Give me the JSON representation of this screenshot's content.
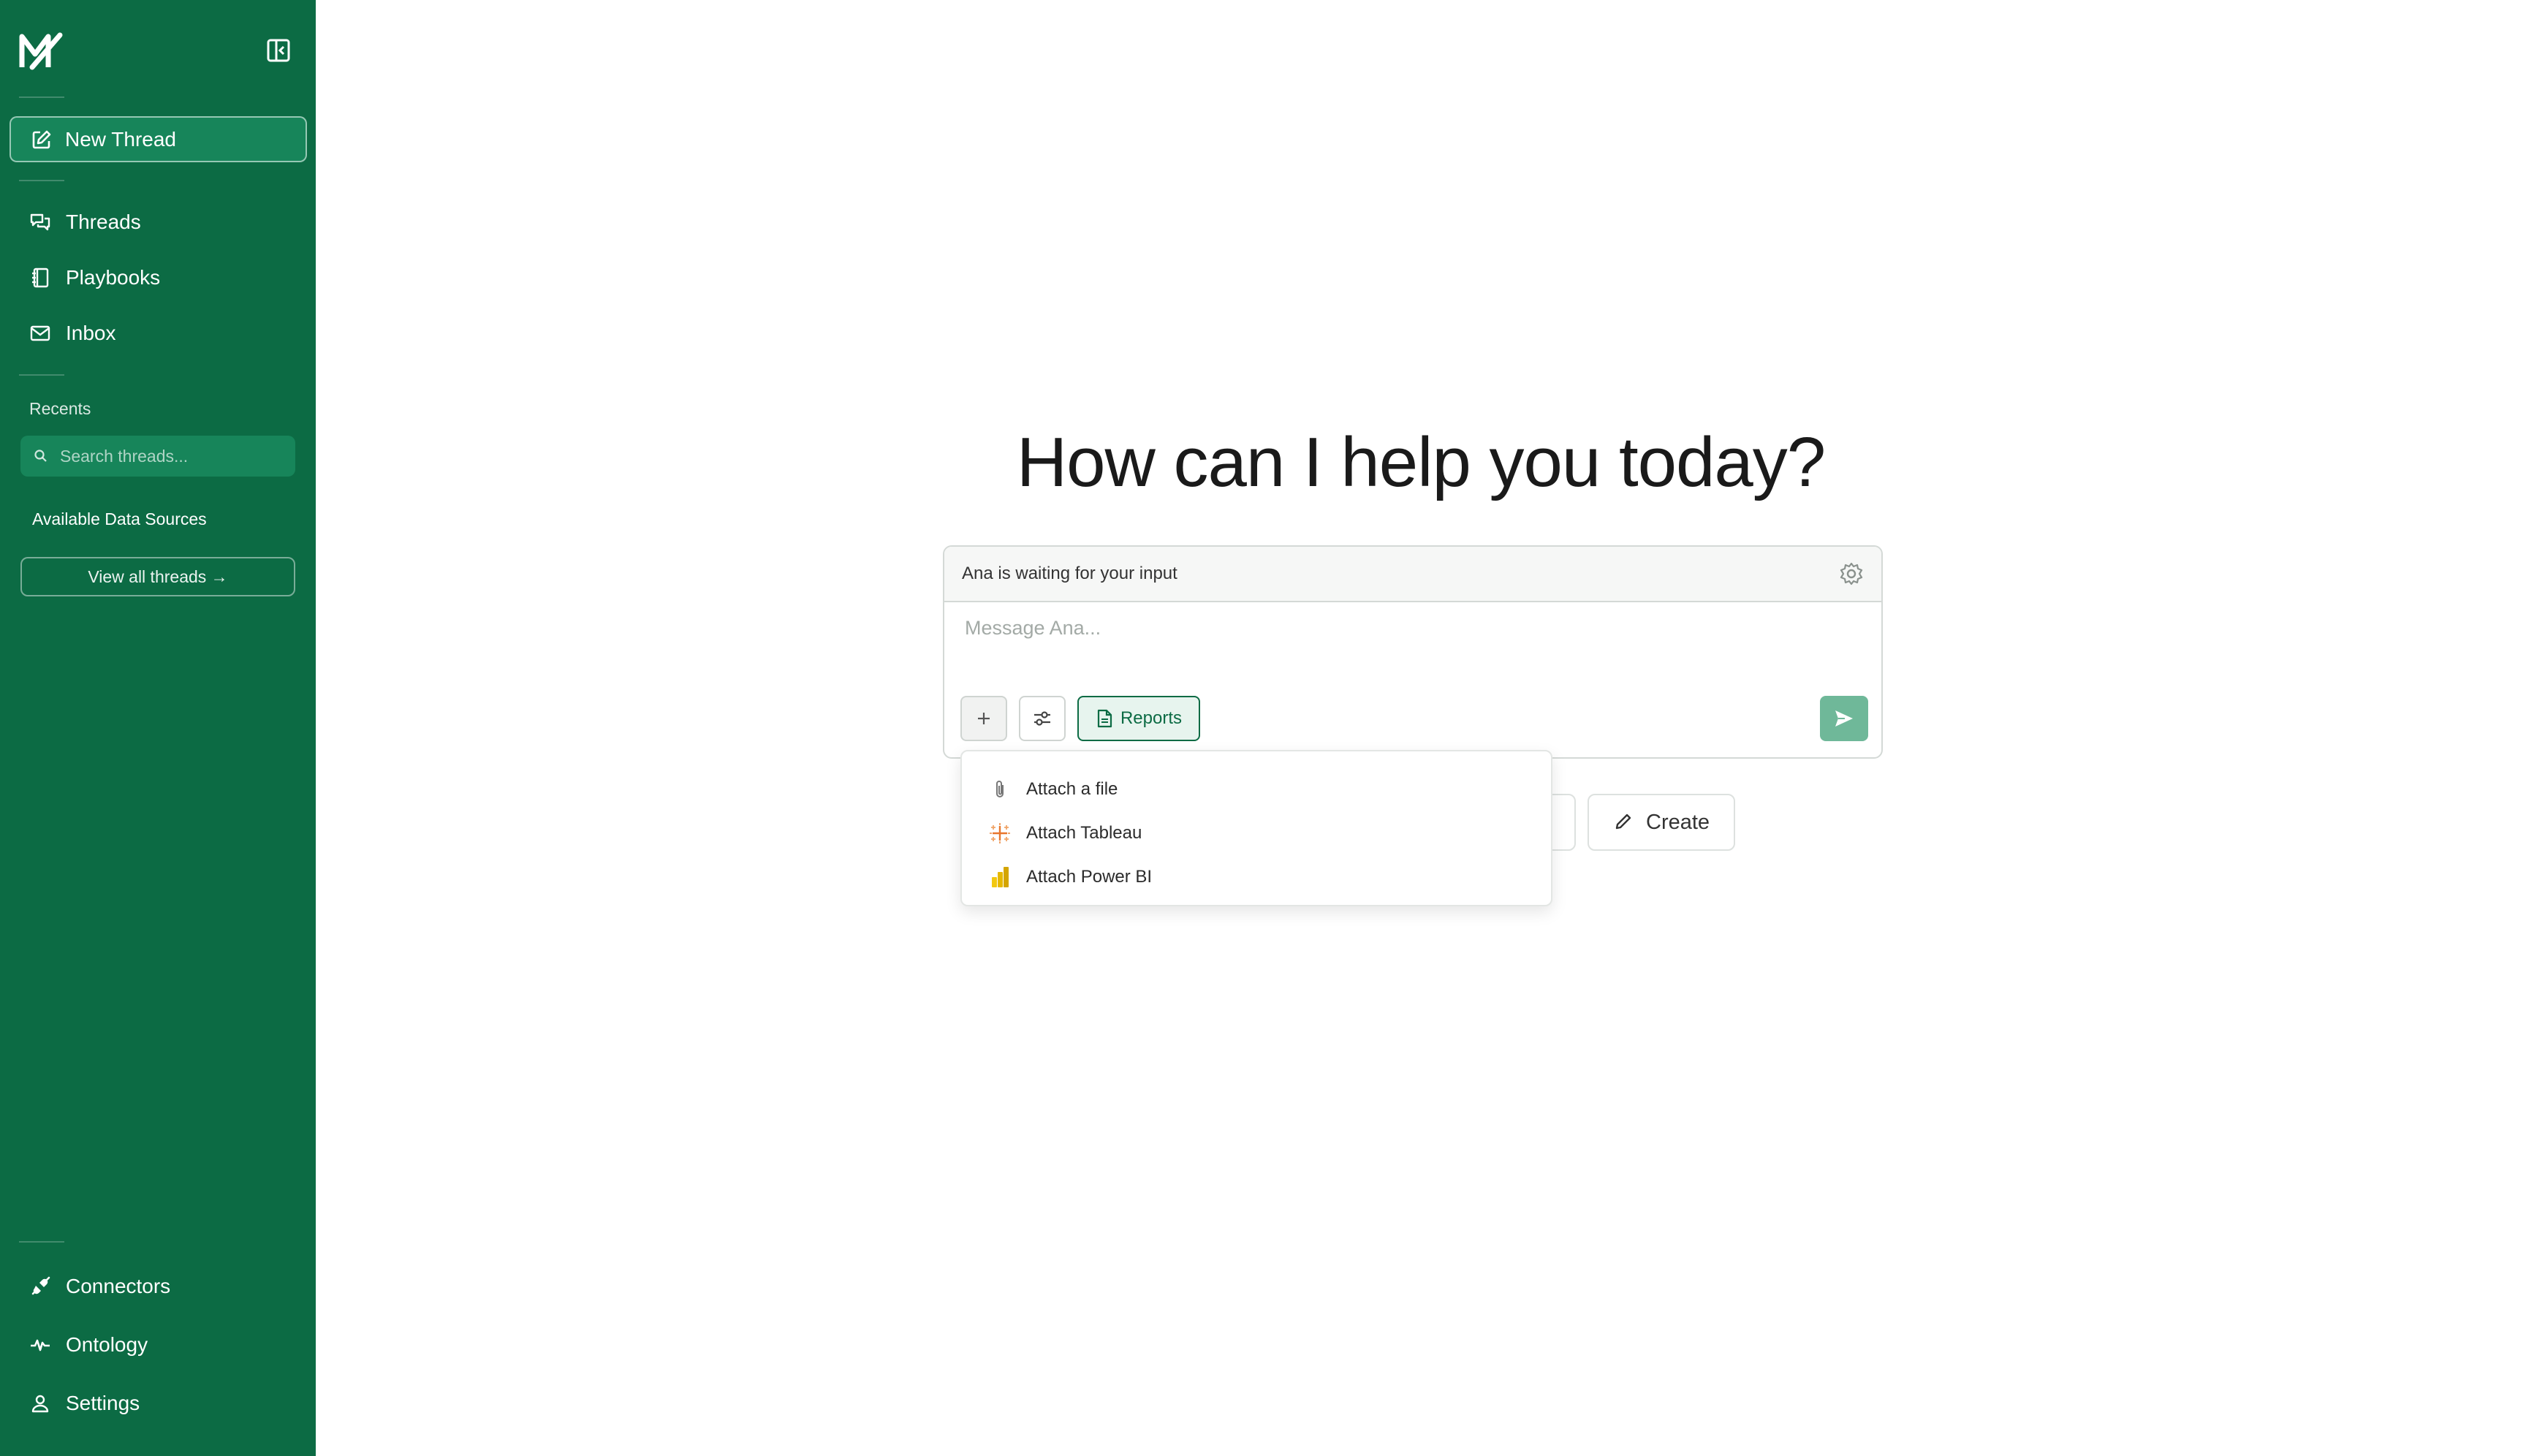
{
  "sidebar": {
    "new_thread": "New Thread",
    "nav": [
      {
        "label": "Threads",
        "icon": "threads-icon"
      },
      {
        "label": "Playbooks",
        "icon": "playbooks-icon"
      },
      {
        "label": "Inbox",
        "icon": "inbox-icon"
      }
    ],
    "recents_label": "Recents",
    "search_placeholder": "Search threads...",
    "sources_label": "Available Data Sources",
    "view_all": "View all threads →",
    "bottom_nav": [
      {
        "label": "Connectors",
        "icon": "plug-icon"
      },
      {
        "label": "Ontology",
        "icon": "pulse-icon"
      },
      {
        "label": "Settings",
        "icon": "user-icon"
      }
    ]
  },
  "main": {
    "headline": "How can I help you today?",
    "status_text": "Ana is waiting for your input",
    "input_placeholder": "Message Ana...",
    "reports_label": "Reports",
    "create_label": "Create"
  },
  "attach_menu": {
    "items": [
      {
        "label": "Attach a file",
        "icon": "paperclip-icon"
      },
      {
        "label": "Attach Tableau",
        "icon": "tableau-icon"
      },
      {
        "label": "Attach Power BI",
        "icon": "powerbi-icon"
      }
    ]
  },
  "colors": {
    "sidebar_bg": "#0c6b44",
    "accent": "#0c6b44",
    "send_button": "#6fb899"
  }
}
